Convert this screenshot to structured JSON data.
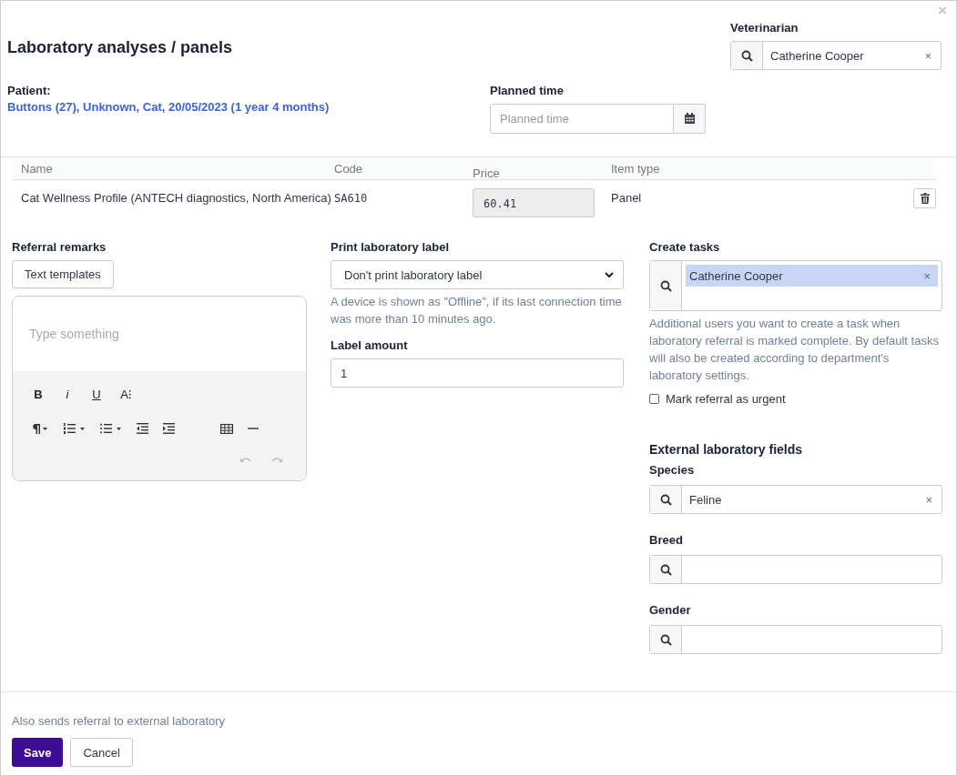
{
  "title": "Laboratory analyses / panels",
  "close": "×",
  "veterinarian": {
    "label": "Veterinarian",
    "value": "Catherine Cooper",
    "clear": "×"
  },
  "patient": {
    "label": "Patient:",
    "value": "Buttons (27), Unknown, Cat, 20/05/2023 (1 year 4 months)"
  },
  "planned_time": {
    "label": "Planned time",
    "placeholder": "Planned time"
  },
  "table": {
    "columns": [
      "Name",
      "Code",
      "Price",
      "Item type"
    ],
    "rows": [
      {
        "name": "Cat Wellness Profile (ANTECH diagnostics, North America)",
        "code": "SA610",
        "price": "60.41",
        "item_type": "Panel"
      }
    ]
  },
  "referral_remarks": {
    "label": "Referral remarks",
    "templates_button": "Text templates",
    "placeholder": "Type something",
    "format_buttons": [
      "B",
      "i",
      "U",
      "A⁝"
    ]
  },
  "print_label": {
    "label": "Print laboratory label",
    "value": "Don't print laboratory label",
    "help": "A device is shown as \"Offline\", if its last connection time was more than 10 minutes ago."
  },
  "label_amount": {
    "label": "Label amount",
    "value": "1"
  },
  "create_tasks": {
    "label": "Create tasks",
    "tags": [
      {
        "text": "Catherine Cooper",
        "remove": "×"
      }
    ],
    "help": "Additional users you want to create a task when laboratory referral is marked complete. By default tasks will also be created according to department's laboratory settings."
  },
  "urgent": {
    "label": "Mark referral as urgent",
    "checked": false
  },
  "external": {
    "heading": "External laboratory fields",
    "fields": [
      {
        "label": "Species",
        "value": "Feline",
        "clear": "×"
      },
      {
        "label": "Breed"
      },
      {
        "label": "Gender"
      }
    ]
  },
  "footer": {
    "note": "Also sends referral to external laboratory",
    "buttons": [
      {
        "label": "Save",
        "kind": "primary"
      },
      {
        "label": "Cancel",
        "kind": "secondary"
      }
    ]
  }
}
